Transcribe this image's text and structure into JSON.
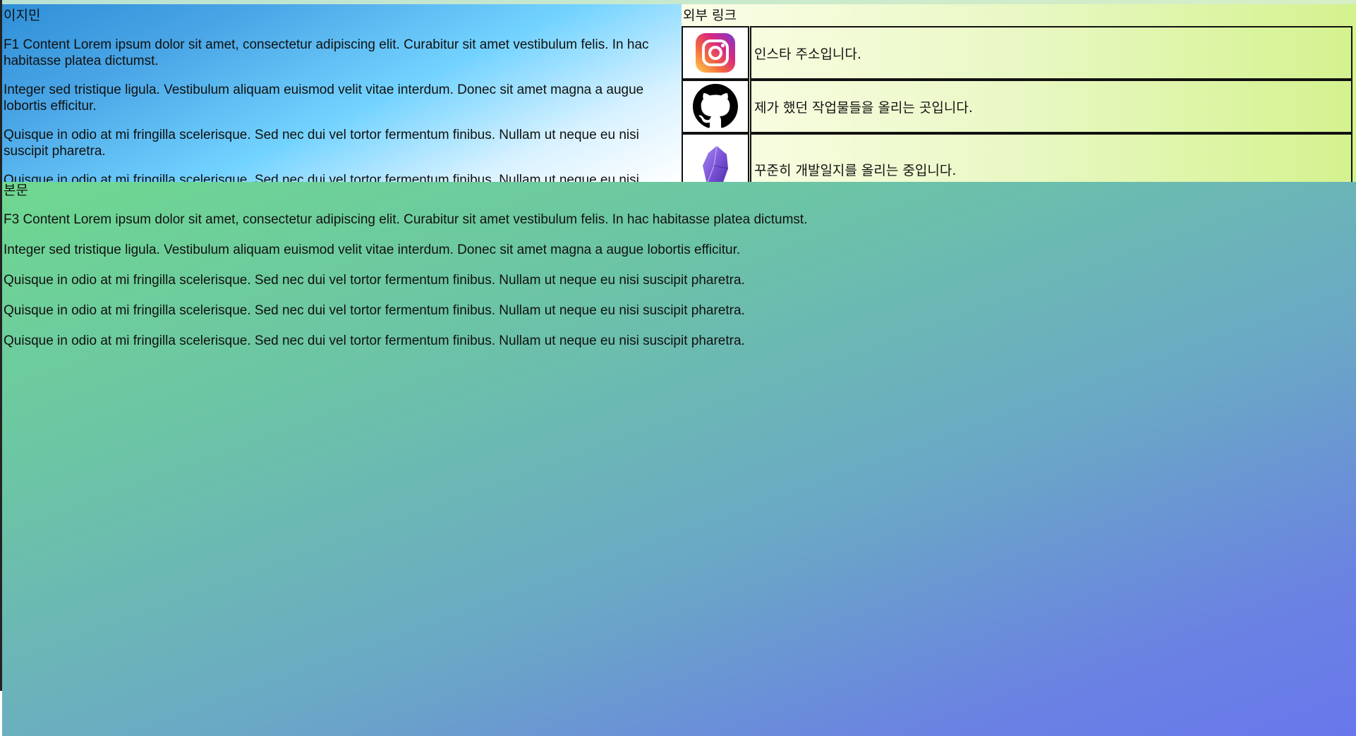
{
  "f1": {
    "title": "이지민",
    "paragraphs": [
      "F1 Content Lorem ipsum dolor sit amet, consectetur adipiscing elit. Curabitur sit amet vestibulum felis. In hac habitasse platea dictumst.",
      "Integer sed tristique ligula. Vestibulum aliquam euismod velit vitae interdum. Donec sit amet magna a augue lobortis efficitur.",
      "Quisque in odio at mi fringilla scelerisque. Sed nec dui vel tortor fermentum finibus. Nullam ut neque eu nisi suscipit pharetra.",
      "Quisque in odio at mi fringilla scelerisque. Sed nec dui vel tortor fermentum finibus. Nullam ut neque eu nisi suscipit pharetra."
    ]
  },
  "links": {
    "title": "외부 링크",
    "items": [
      {
        "icon": "instagram-icon",
        "text": "인스타 주소입니다."
      },
      {
        "icon": "github-icon",
        "text": "제가 했던 작업물들을 올리는 곳입니다."
      },
      {
        "icon": "obsidian-icon",
        "text": "꾸준히 개발일지를 올리는 중입니다."
      }
    ]
  },
  "main": {
    "title": "본문",
    "paragraphs": [
      "F3 Content Lorem ipsum dolor sit amet, consectetur adipiscing elit. Curabitur sit amet vestibulum felis. In hac habitasse platea dictumst.",
      "Integer sed tristique ligula. Vestibulum aliquam euismod velit vitae interdum. Donec sit amet magna a augue lobortis efficitur.",
      "Quisque in odio at mi fringilla scelerisque. Sed nec dui vel tortor fermentum finibus. Nullam ut neque eu nisi suscipit pharetra.",
      "Quisque in odio at mi fringilla scelerisque. Sed nec dui vel tortor fermentum finibus. Nullam ut neque eu nisi suscipit pharetra.",
      "Quisque in odio at mi fringilla scelerisque. Sed nec dui vel tortor fermentum finibus. Nullam ut neque eu nisi suscipit pharetra."
    ]
  },
  "colors": {
    "f1_gradient": [
      "#2f8fd8",
      "#73d3ff",
      "#ffffff"
    ],
    "links_gradient": [
      "#fbfde7",
      "#d4f28e"
    ],
    "main_gradient": [
      "#6fd890",
      "#6aa9c5",
      "#6878ec"
    ],
    "border": "#111111"
  }
}
